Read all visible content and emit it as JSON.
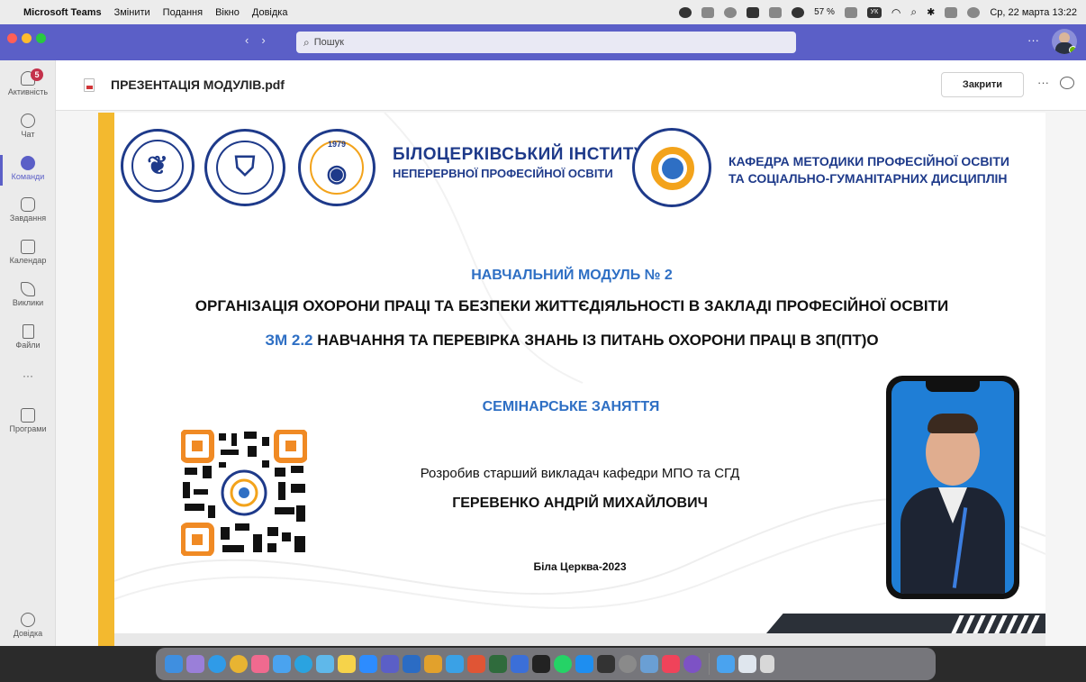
{
  "menubar": {
    "app_name": "Microsoft Teams",
    "items": [
      "Змінити",
      "Подання",
      "Вікно",
      "Довідка"
    ],
    "battery": "57 %",
    "keyboard": "УК",
    "datetime": "Ср, 22 марта 13:22"
  },
  "titlebar": {
    "search_placeholder": "Пошук",
    "more": "···"
  },
  "rail": {
    "activity_badge": "5",
    "items": [
      {
        "label": "Активність",
        "icon": "bell-icon"
      },
      {
        "label": "Чат",
        "icon": "chat-icon"
      },
      {
        "label": "Команди",
        "icon": "teams-icon"
      },
      {
        "label": "Завдання",
        "icon": "tasks-icon"
      },
      {
        "label": "Календар",
        "icon": "calendar-icon"
      },
      {
        "label": "Виклики",
        "icon": "phone-icon"
      },
      {
        "label": "Файли",
        "icon": "file-icon"
      },
      {
        "label": "···",
        "icon": "more-icon"
      },
      {
        "label": "Програми",
        "icon": "apps-icon"
      }
    ],
    "help_label": "Довідка"
  },
  "file": {
    "name": "ПРЕЗЕНТАЦІЯ МОДУЛІВ.pdf",
    "close_label": "Закрити",
    "more": "···"
  },
  "slide": {
    "institute_line1": "БІЛОЦЕРКІВСЬКИЙ ІНСТИТУТ",
    "institute_line2": "НЕПЕРЕРВНОЇ ПРОФЕСІЙНОЇ ОСВІТИ",
    "dept_line1": "КАФЕДРА МЕТОДИКИ ПРОФЕСІЙНОЇ ОСВІТИ",
    "dept_line2": "ТА СОЦІАЛЬНО-ГУМАНІТАРНИХ ДИСЦИПЛІН",
    "module": "НАВЧАЛЬНИЙ МОДУЛЬ № 2",
    "main_title": "ОРГАНІЗАЦІЯ ОХОРОНИ ПРАЦІ ТА БЕЗПЕКИ ЖИТТЄДІЯЛЬНОСТІ В ЗАКЛАДІ ПРОФЕСІЙНОЇ ОСВІТИ",
    "sub_code": "ЗМ 2.2",
    "sub_title": "НАВЧАННЯ ТА ПЕРЕВІРКА ЗНАНЬ ІЗ ПИТАНЬ ОХОРОНИ ПРАЦІ В ЗП(ПТ)О",
    "seminar": "СЕМІНАРСЬКЕ ЗАНЯТТЯ",
    "developer": "Розробив старший викладач кафедри МПО та СГД",
    "author": "ГЕРЕВЕНКО АНДРІЙ МИХАЙЛОВИЧ",
    "city_year": "Біла Церква-2023",
    "logo3_year": "1979"
  },
  "colors": {
    "teams_purple": "#5b5fc7",
    "slide_blue": "#1e3a8a",
    "accent_blue": "#2e6fc4",
    "accent_yellow": "#f3b92f",
    "qr_orange": "#f08a24"
  },
  "dock": {
    "apps": [
      "finder",
      "launchpad",
      "safari",
      "chrome",
      "photos",
      "mail",
      "telegram",
      "app",
      "notes",
      "zoom",
      "teams",
      "word",
      "app",
      "app",
      "app",
      "app",
      "app",
      "app",
      "whatsapp",
      "appstore",
      "calculator",
      "settings",
      "preview",
      "music",
      "viber",
      "downloads",
      "folder",
      "trash"
    ]
  }
}
